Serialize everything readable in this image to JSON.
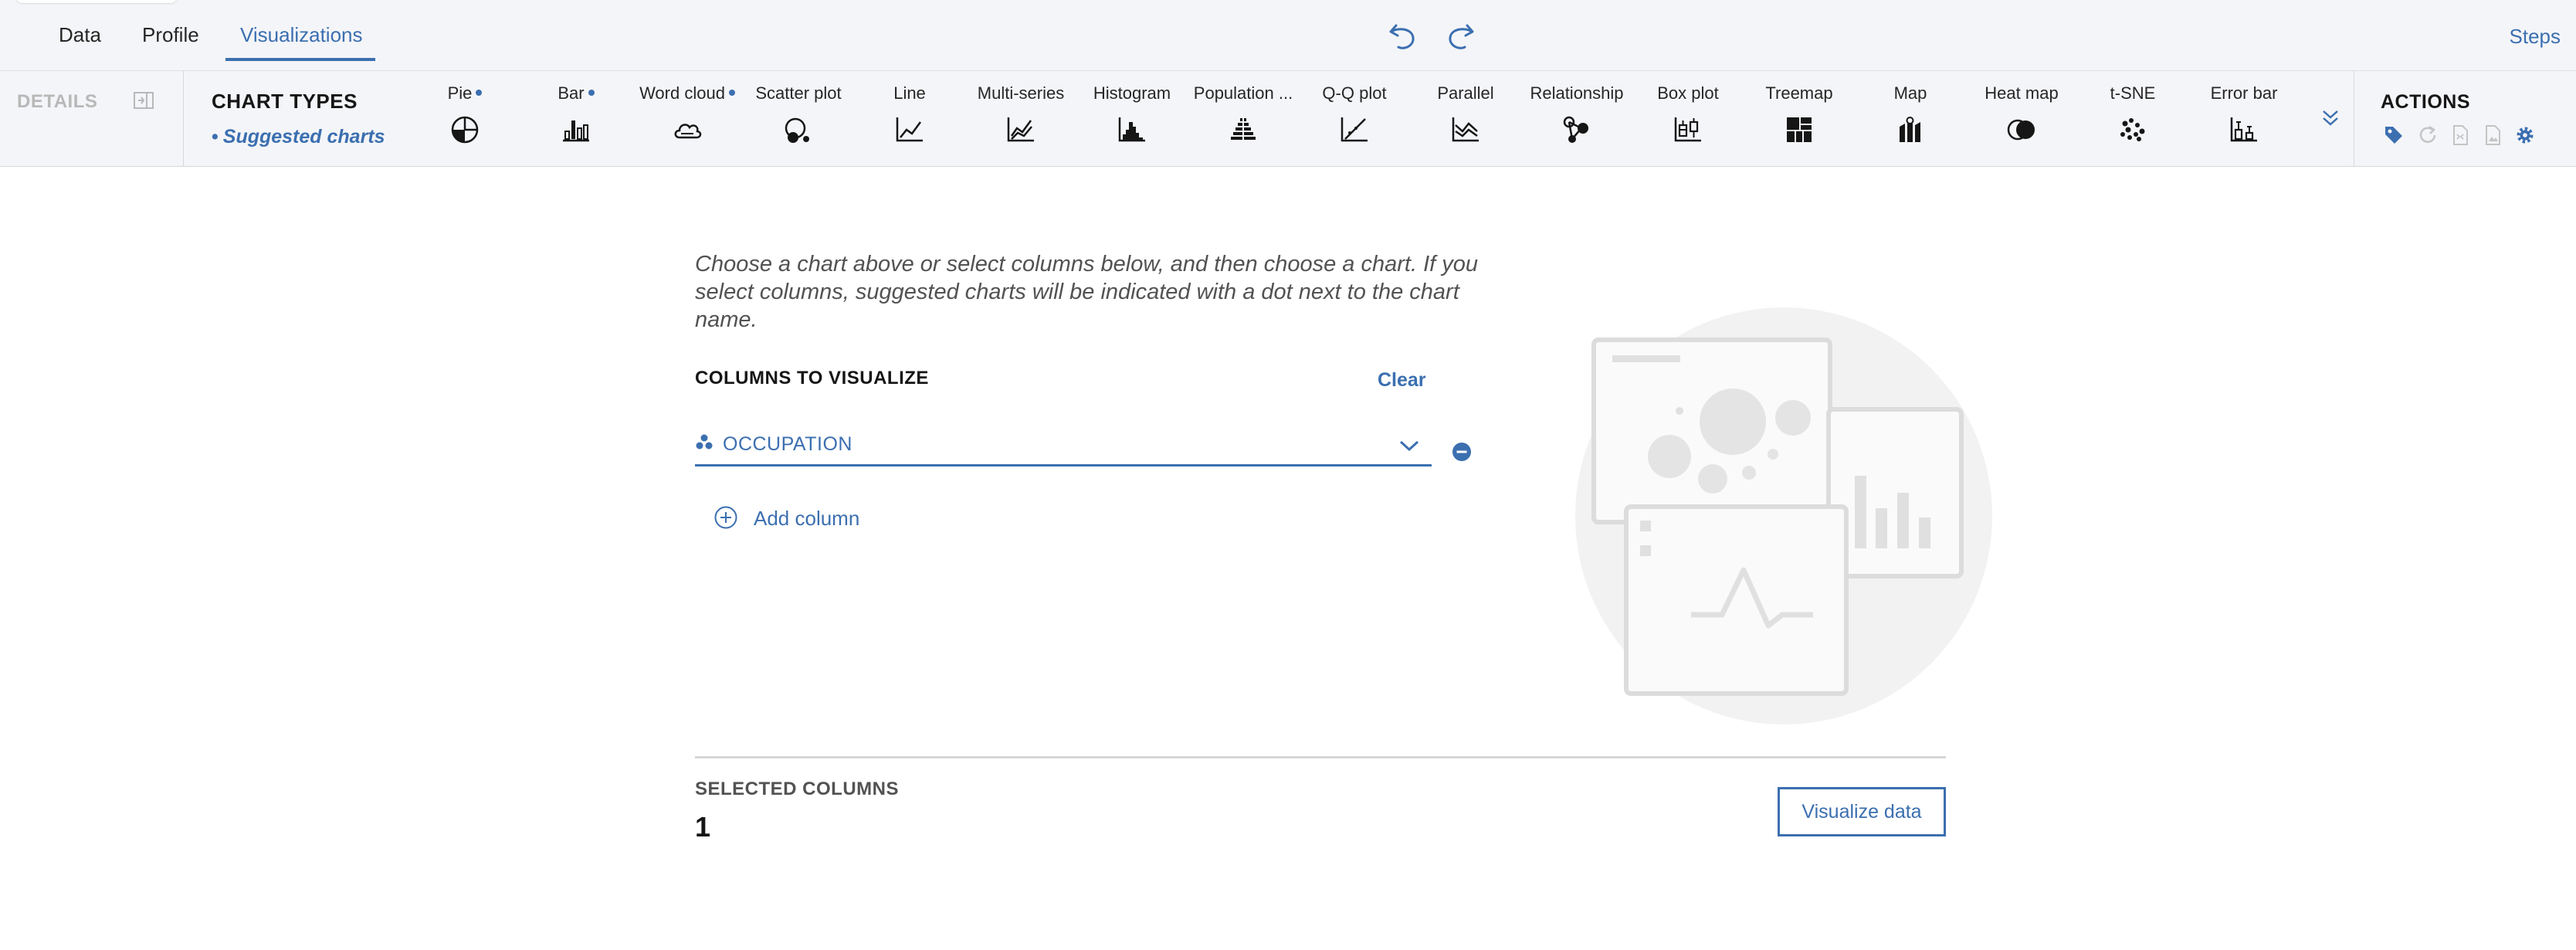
{
  "nav": {
    "tabs": [
      {
        "label": "Data"
      },
      {
        "label": "Profile"
      },
      {
        "label": "Visualizations"
      }
    ],
    "steps": "Steps"
  },
  "toolbar": {
    "details_label": "DETAILS",
    "chart_types_label": "CHART TYPES",
    "suggested_label": "Suggested charts",
    "charts": [
      {
        "label": "Pie",
        "suggested": true,
        "icon": "pie-chart-icon"
      },
      {
        "label": "Bar",
        "suggested": true,
        "icon": "bar-chart-icon"
      },
      {
        "label": "Word cloud",
        "suggested": true,
        "icon": "word-cloud-icon"
      },
      {
        "label": "Scatter plot",
        "suggested": false,
        "icon": "scatter-plot-icon"
      },
      {
        "label": "Line",
        "suggested": false,
        "icon": "line-chart-icon"
      },
      {
        "label": "Multi-series",
        "suggested": false,
        "icon": "multi-series-icon"
      },
      {
        "label": "Histogram",
        "suggested": false,
        "icon": "histogram-icon"
      },
      {
        "label": "Population ...",
        "suggested": false,
        "icon": "population-pyramid-icon"
      },
      {
        "label": "Q-Q plot",
        "suggested": false,
        "icon": "qq-plot-icon"
      },
      {
        "label": "Parallel",
        "suggested": false,
        "icon": "parallel-icon"
      },
      {
        "label": "Relationship",
        "suggested": false,
        "icon": "relationship-icon"
      },
      {
        "label": "Box plot",
        "suggested": false,
        "icon": "box-plot-icon"
      },
      {
        "label": "Treemap",
        "suggested": false,
        "icon": "treemap-icon"
      },
      {
        "label": "Map",
        "suggested": false,
        "icon": "map-icon"
      },
      {
        "label": "Heat map",
        "suggested": false,
        "icon": "heat-map-icon"
      },
      {
        "label": "t-SNE",
        "suggested": false,
        "icon": "tsne-icon"
      },
      {
        "label": "Error bar",
        "suggested": false,
        "icon": "error-bar-icon"
      }
    ],
    "actions_label": "ACTIONS"
  },
  "main": {
    "intro": "Choose a chart above or select columns below, and then choose a chart. If you select columns, suggested charts will be indicated with a dot next to the chart name.",
    "columns_title": "COLUMNS TO VISUALIZE",
    "clear_label": "Clear",
    "column_value": "OCCUPATION",
    "add_column_label": "Add column",
    "selected_title": "SELECTED COLUMNS",
    "selected_count": "1",
    "visualize_label": "Visualize data"
  },
  "colors": {
    "accent": "#3b6fb0",
    "toolbar_bg": "#f4f5f8",
    "illustration": "#e4e4e4"
  }
}
